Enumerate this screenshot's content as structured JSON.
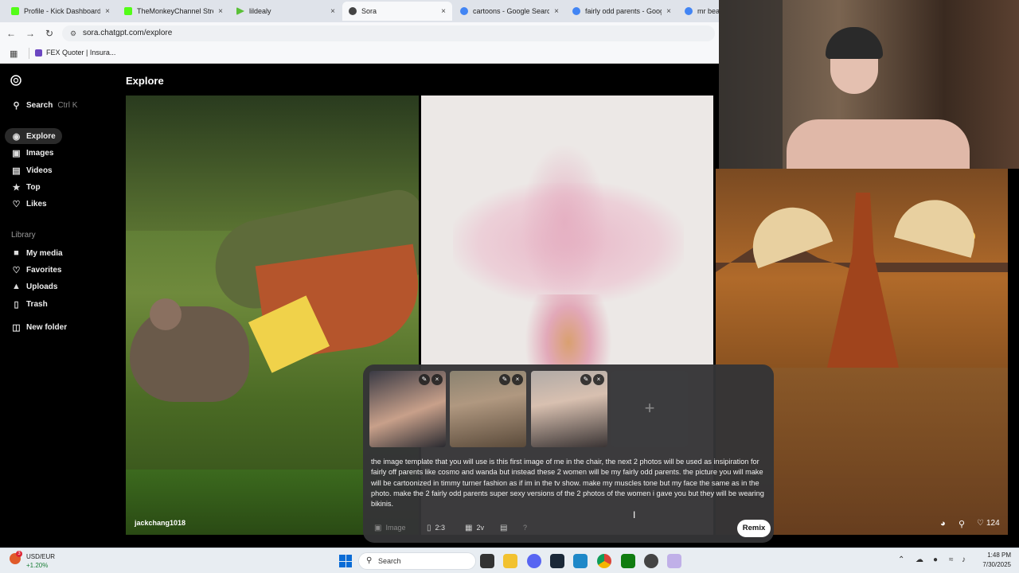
{
  "browser": {
    "tabs": [
      {
        "label": "Profile - Kick Dashboard",
        "color": "#53fc18",
        "active": false
      },
      {
        "label": "TheMonkeyChannel Strea",
        "color": "#53fc18",
        "active": false
      },
      {
        "label": "lildealy",
        "color": "#5ac037",
        "active": false
      },
      {
        "label": "Sora",
        "color": "#444444",
        "active": true
      },
      {
        "label": "cartoons - Google Search",
        "color": "#4285f4",
        "active": false
      },
      {
        "label": "fairly odd parents - Goog",
        "color": "#4285f4",
        "active": false
      },
      {
        "label": "mr bean",
        "color": "#4285f4",
        "active": false
      }
    ],
    "close_glyph": "×",
    "url": "sora.chatgpt.com/explore",
    "bookmark": "FEX Quoter | Insura..."
  },
  "sidebar": {
    "search_label": "Search",
    "search_shortcut": "Ctrl K",
    "nav": [
      "Explore",
      "Images",
      "Videos",
      "Top",
      "Likes"
    ],
    "library_heading": "Library",
    "library": [
      "My media",
      "Favorites",
      "Uploads",
      "Trash"
    ],
    "new_folder": "New folder"
  },
  "main": {
    "title": "Explore",
    "tiles": [
      {
        "author": "jackchang1018"
      },
      {
        "author": ""
      },
      {
        "like_count": "124"
      }
    ]
  },
  "composer": {
    "add_glyph": "+",
    "prompt": "the image template that you will use is this first image of me in the chair, the next 2 photos will be used as insipiration for fairly off parents like cosmo and wanda but instead these 2 women will be my fairly odd parents. the picture you will make will be cartoonized in timmy turner fashion as if im in the tv show. make my muscles tone but my face the same as in the photo. make the 2 fairly odd parents super sexy versions of the 2 photos of the women i gave you but they will be wearing bikinis.",
    "image_label": "Image",
    "aspect": "2:3",
    "variations": "2v",
    "help": "?",
    "remix": "Remix"
  },
  "taskbar": {
    "ticker_name": "USD/EUR",
    "ticker_change": "+1.20%",
    "search_placeholder": "Search",
    "time": "1:48 PM",
    "date": "7/30/2025",
    "notification_badge": "3"
  }
}
